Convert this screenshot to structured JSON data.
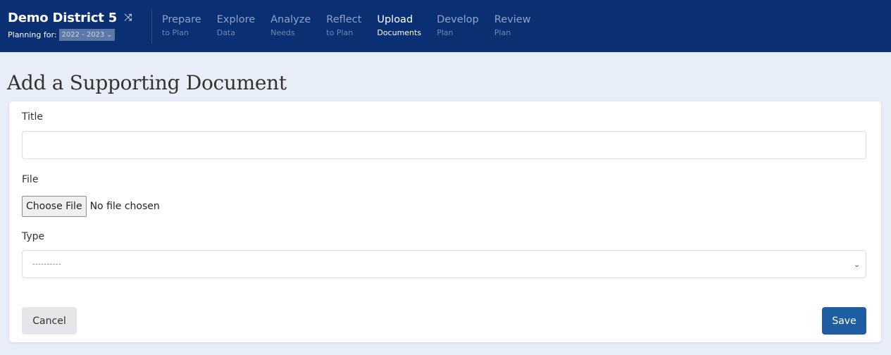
{
  "header": {
    "district": "Demo District 5",
    "planning_label": "Planning for:",
    "year": "2022 - 2023",
    "nav": [
      {
        "main": "Prepare",
        "sub": "to Plan"
      },
      {
        "main": "Explore",
        "sub": "Data"
      },
      {
        "main": "Analyze",
        "sub": "Needs"
      },
      {
        "main": "Reflect",
        "sub": "to Plan"
      },
      {
        "main": "Upload",
        "sub": "Documents"
      },
      {
        "main": "Develop",
        "sub": "Plan"
      },
      {
        "main": "Review",
        "sub": "Plan"
      }
    ],
    "active_nav": "Upload"
  },
  "page": {
    "title": "Add a Supporting Document"
  },
  "form": {
    "title_label": "Title",
    "title_value": "",
    "file_label": "File",
    "file_button": "Choose File",
    "file_status": "No file chosen",
    "type_label": "Type",
    "type_value": "----------",
    "cancel_label": "Cancel",
    "save_label": "Save"
  },
  "icons": {
    "shuffle": "shuffle-icon",
    "year_chevron": "chevron-down-icon",
    "type_chevron": "chevron-down-icon"
  },
  "colors": {
    "header_bg": "#0b2f73",
    "save_bg": "#1f5da3",
    "page_bg": "#e8eef7"
  }
}
